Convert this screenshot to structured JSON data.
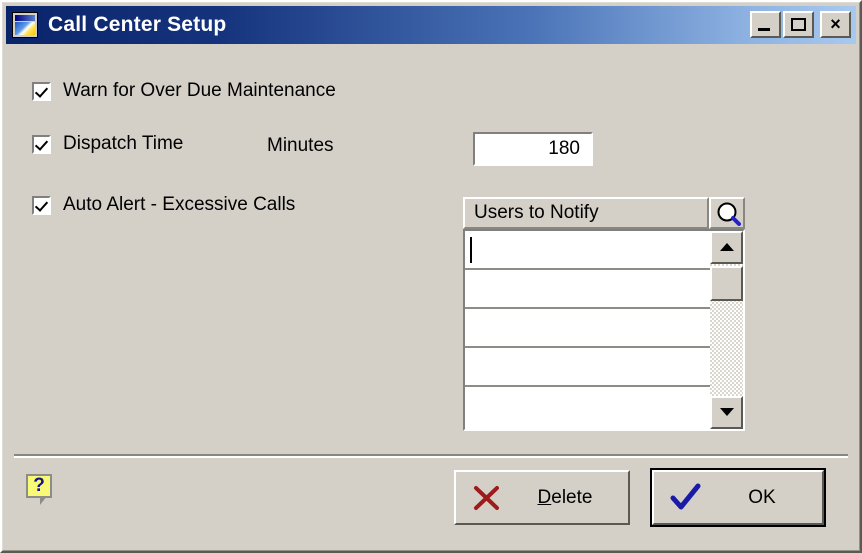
{
  "window": {
    "title": "Call Center Setup",
    "icon": "window-app-icon",
    "titlebar_gradient_from": "#0a246a",
    "titlebar_gradient_to": "#a8c9ef",
    "face_color": "#d4d0c8",
    "buttons": {
      "minimize": "minimize-button",
      "maximize": "maximize-button",
      "close": "close-button",
      "close_glyph": "×"
    }
  },
  "options": {
    "warn_overdue": {
      "label": "Warn for Over Due Maintenance",
      "checked": true
    },
    "dispatch_time": {
      "label": "Dispatch Time",
      "checked": true,
      "units_label": "Minutes",
      "value": "180"
    },
    "auto_alert": {
      "label": "Auto Alert - Excessive Calls",
      "checked": true
    }
  },
  "grid": {
    "column_header": "Users to Notify",
    "search_icon": "magnifier-icon",
    "rows": [
      "",
      "",
      "",
      "",
      ""
    ],
    "active_row_index": 0,
    "scrollbar": {
      "up_arrow": "▲",
      "down_arrow": "▼"
    }
  },
  "footer": {
    "help_icon": "help-question-icon",
    "delete": {
      "label_prefix": "",
      "accel": "D",
      "label_rest": "elete",
      "icon": "red-x-icon",
      "icon_color": "#9e1b1b"
    },
    "ok": {
      "label": "OK",
      "icon": "blue-check-icon",
      "icon_color": "#1a1aa8",
      "is_default": true
    }
  }
}
